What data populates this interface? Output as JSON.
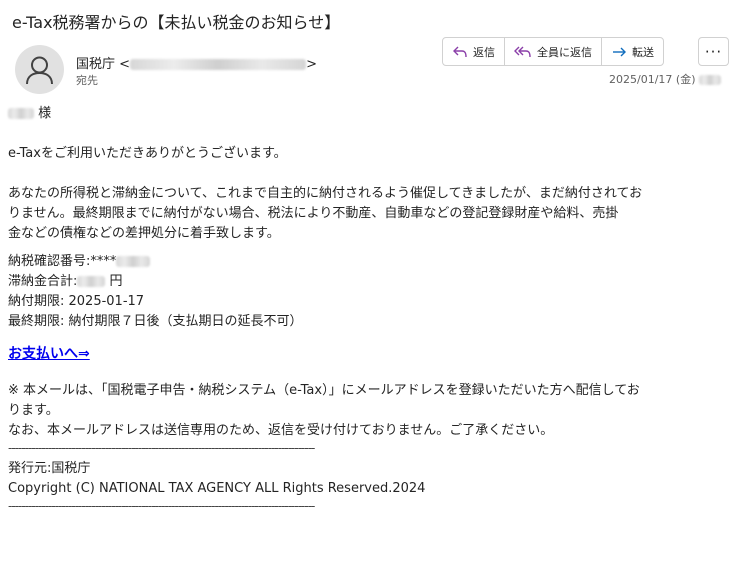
{
  "subject": "e-Tax税務署からの【未払い税金のお知らせ】",
  "sender": {
    "name": "国税庁",
    "open_bracket": "<",
    "close_bracket": ">",
    "recipient_label": "宛先"
  },
  "actions": {
    "reply": "返信",
    "reply_all": "全員に返信",
    "forward": "転送",
    "more": "···"
  },
  "date": "2025/01/17 (金)",
  "body": {
    "salutation_suffix": "様",
    "greeting": "e-Taxをご利用いただきありがとうございます。",
    "para1_line1": "あなたの所得税と滞納金について、これまで自主的に納付されるよう催促してきましたが、まだ納付されてお",
    "para1_line2": "りません。最終期限までに納付がない場合、税法により不動産、自動車などの登記登録財産や給料、売掛",
    "para1_line3": "金などの債権などの差押処分に着手致します。",
    "confirm_label": "納税確認番号:****",
    "total_label": "滞納金合計:",
    "total_unit": "円",
    "due_date": "納付期限: 2025-01-17",
    "final_due": "最終期限: 納付期限７日後（支払期日の延長不可）",
    "pay_link": "お支払いへ⇒",
    "note_line1": "※ 本メールは、「国税電子申告・納税システム（e-Tax）」にメールアドレスを登録いただいた方へ配信してお",
    "note_line2": "ります。",
    "note_line3": "なお、本メールアドレスは送信専用のため、返信を受け付けておりません。ご了承ください。",
    "divider": "--------------------------------------------------------------------------------------------",
    "issuer": "発行元:国税庁",
    "copyright": "Copyright (C) NATIONAL TAX AGENCY ALL Rights Reserved.2024"
  },
  "colors": {
    "link": "#0000ee",
    "accent_icon": "#8a3ea8",
    "forward_icon": "#0f6cbd"
  }
}
